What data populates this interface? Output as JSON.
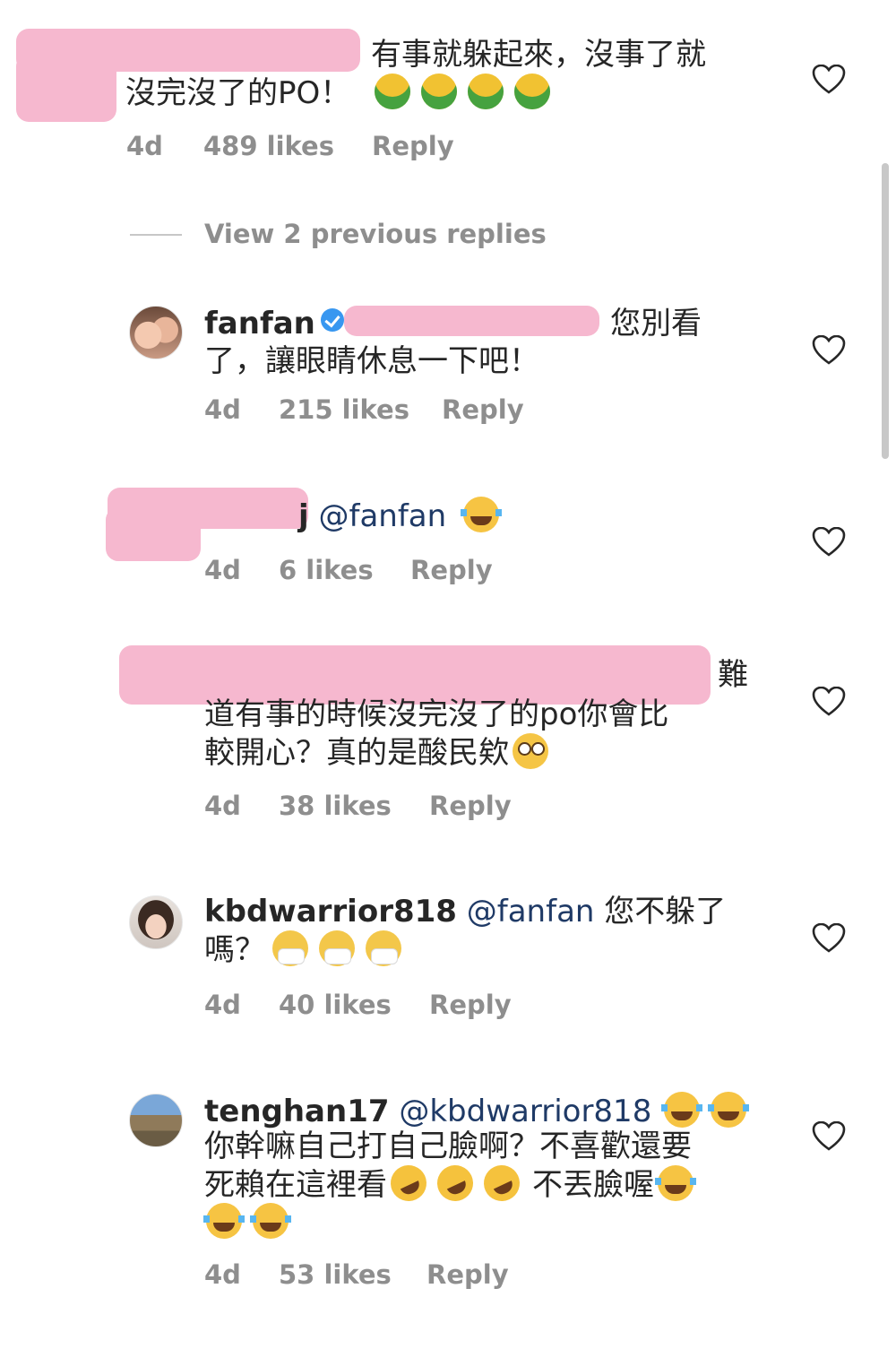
{
  "colors": {
    "text": "#262626",
    "meta": "#8e8e8e",
    "mention": "#1f3a66",
    "redaction": "#f6b8cf",
    "verified": "#3897f0"
  },
  "comments": [
    {
      "lines": [
        "有事就躲起來，沒事了就",
        "沒完沒了的PO！"
      ],
      "emoji_after_line2": [
        "nauseated-face-icon",
        "nauseated-face-icon",
        "nauseated-face-icon",
        "nauseated-face-icon"
      ],
      "time": "4d",
      "likes": "489 likes",
      "reply": "Reply"
    }
  ],
  "view_previous_replies": "View 2 previous replies",
  "replies": [
    {
      "username": "fanfan",
      "verified": true,
      "line1_tail": "您別看",
      "line2": "了，讓眼睛休息一下吧！",
      "time": "4d",
      "likes": "215 likes",
      "reply": "Reply"
    },
    {
      "username_tail": "j",
      "mention": "@fanfan",
      "emoji": [
        "laughing-tears-icon"
      ],
      "time": "4d",
      "likes": "6 likes",
      "reply": "Reply"
    },
    {
      "line1_tail": "難",
      "line2": "道有事的時候沒完沒了的po你會比",
      "line3": "較開心？真的是酸民欸",
      "emoji": [
        "eye-roll-icon"
      ],
      "time": "4d",
      "likes": "38 likes",
      "reply": "Reply"
    },
    {
      "username": "kbdwarrior818",
      "mention": "@fanfan",
      "line1_text": "您不躲了",
      "line2": "嗎？",
      "emoji": [
        "mask-face-icon",
        "mask-face-icon",
        "mask-face-icon"
      ],
      "time": "4d",
      "likes": "40 likes",
      "reply": "Reply"
    },
    {
      "username": "tenghan17",
      "mention": "@kbdwarrior818",
      "line2": "你幹嘛自己打自己臉啊？不喜歡還要",
      "line3a": "死賴在這裡看",
      "line3b": "不丟臉喔",
      "time": "4d",
      "likes": "53 likes",
      "reply": "Reply"
    }
  ]
}
